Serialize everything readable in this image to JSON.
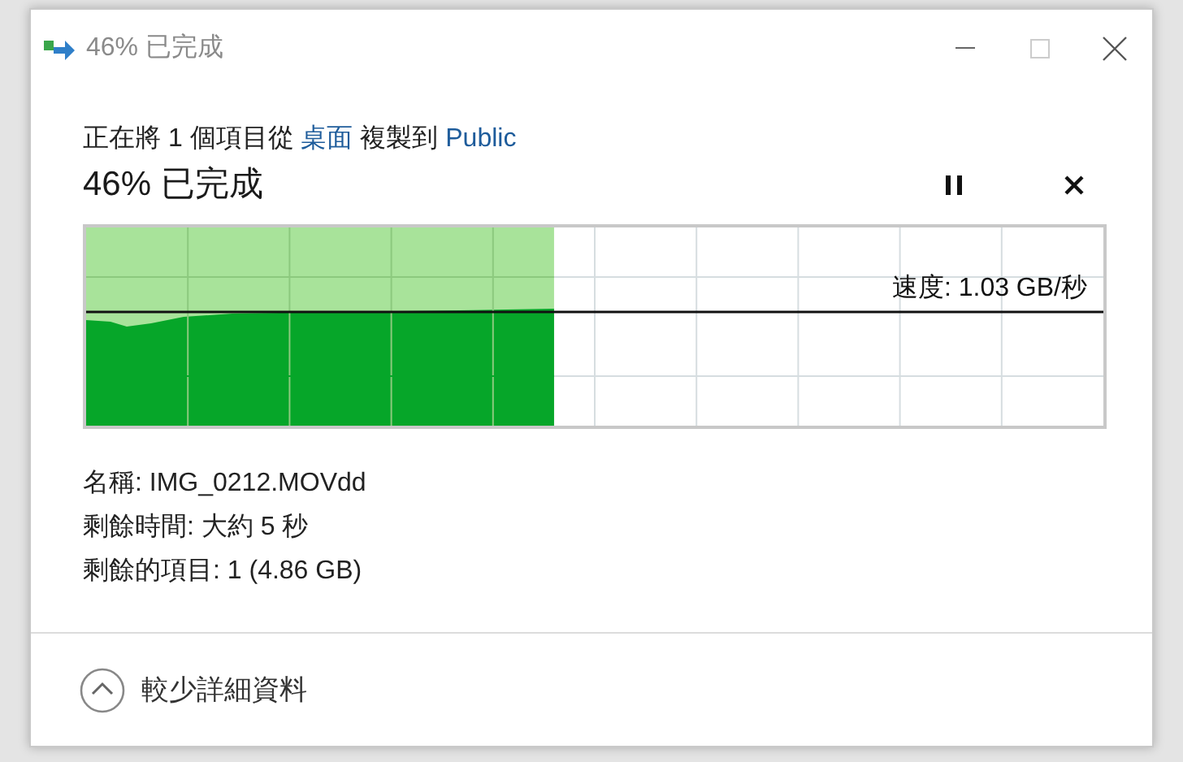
{
  "window": {
    "title": "46% 已完成"
  },
  "header": {
    "parts": [
      {
        "kind": "text",
        "text": "正在將 1 個項目從 "
      },
      {
        "kind": "link",
        "text": "桌面"
      },
      {
        "kind": "text",
        "text": " 複製到 "
      },
      {
        "kind": "link",
        "text": "Public"
      }
    ]
  },
  "progress": {
    "title": "46% 已完成",
    "level": 0.46,
    "speed": "速度: 1.03 GB/秒"
  },
  "details": [
    "名稱: IMG_0212.MOVdd",
    "剩餘時間: 大約 5 秒",
    "剩餘的項目: 1 (4.86 GB)"
  ],
  "footer": {
    "toggle": "較少詳細資料",
    "expanded": true
  }
}
